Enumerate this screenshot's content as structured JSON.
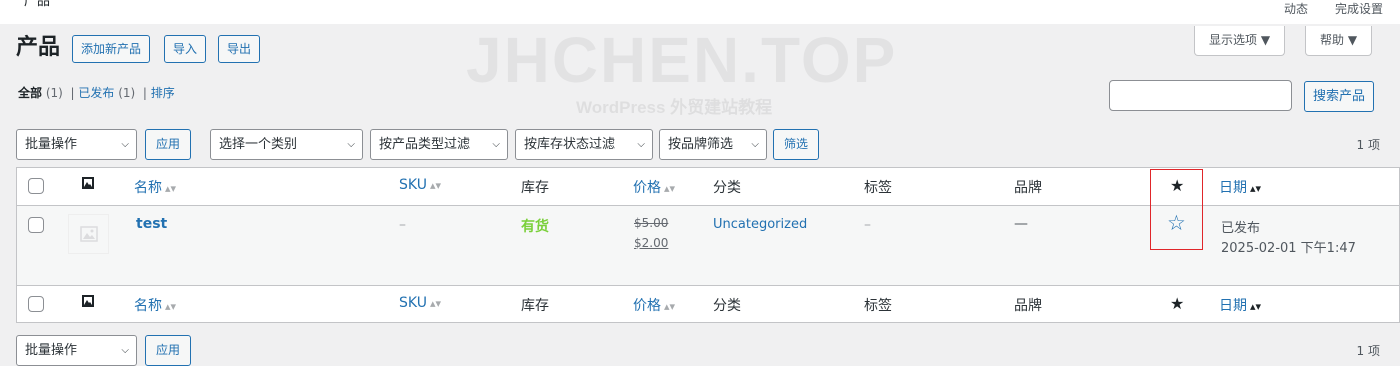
{
  "topbar": {
    "title_fragment": "产品",
    "links": [
      "动态",
      "完成设置"
    ]
  },
  "watermark": {
    "main": "JHCHEN.TOP",
    "sub": "WordPress 外贸建站教程"
  },
  "screen_tabs": {
    "screen_options": "显示选项 ▼",
    "help": "帮助 ▼"
  },
  "header": {
    "title": "产品",
    "add_new": "添加新产品",
    "import": "导入",
    "export": "导出"
  },
  "views": {
    "all_label": "全部",
    "all_count": "(1)",
    "separator": "|",
    "published_label": "已发布",
    "published_count": "(1)",
    "sort_label": "排序"
  },
  "search": {
    "placeholder": "",
    "button": "搜索产品"
  },
  "filters": {
    "bulk_action": "批量操作",
    "apply": "应用",
    "category": "选择一个类别",
    "product_type": "按产品类型过滤",
    "stock_status": "按库存状态过滤",
    "brand": "按品牌筛选",
    "filter_button": "筛选"
  },
  "pagination": {
    "top_count": "1 项",
    "bottom_count": "1 项"
  },
  "table": {
    "columns": {
      "name": "名称",
      "sku": "SKU",
      "stock": "库存",
      "price": "价格",
      "category": "分类",
      "tags": "标签",
      "brand": "品牌",
      "date": "日期"
    },
    "icons": {
      "thumb_column": "image-icon",
      "featured_column": "star-filled-icon",
      "featured_toggle": "star-outline-icon",
      "sort": "sort-arrows-icon"
    },
    "rows": [
      {
        "name": "test",
        "sku": "–",
        "stock": "有货",
        "regular_price": "$5.00",
        "sale_price": "$2.00",
        "category": "Uncategorized",
        "tags": "–",
        "brand": "—",
        "status": "已发布",
        "date": "2025-02-01 下午1:47"
      }
    ]
  },
  "colors": {
    "link": "#2271b1",
    "in_stock": "#7ad03a",
    "highlight": "#e0262a",
    "background": "#f0f0f1"
  }
}
